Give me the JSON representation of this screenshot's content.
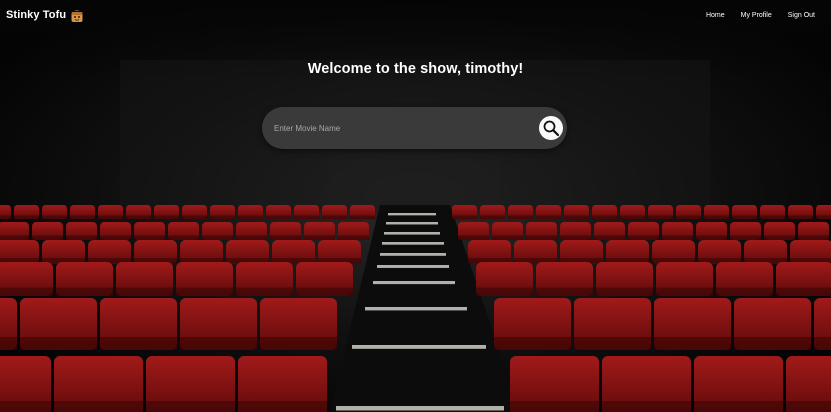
{
  "navbar": {
    "brand": "Stinky Tofu",
    "links": [
      {
        "label": "Home"
      },
      {
        "label": "My Profile"
      },
      {
        "label": "Sign Out"
      }
    ]
  },
  "hero": {
    "welcome": "Welcome to the show, timothy!"
  },
  "search": {
    "placeholder": "Enter Movie Name",
    "value": ""
  },
  "icons": {
    "brand_logo": "tofu-icon",
    "search_button": "magnifier-icon"
  },
  "colors": {
    "seat": "#8b1414",
    "background": "#050505",
    "search_bar": "#3a3a3a"
  }
}
